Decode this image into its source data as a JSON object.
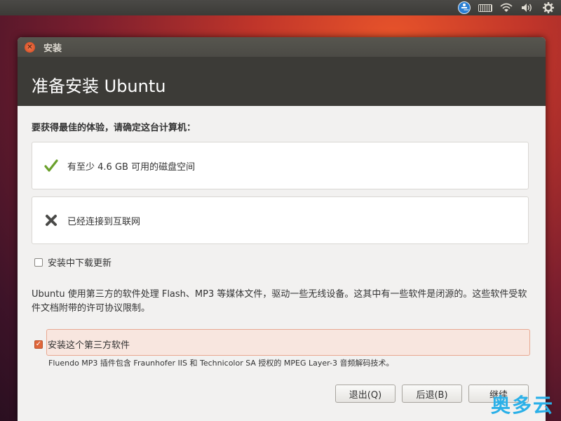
{
  "panel": {
    "icons": [
      "accessibility-icon",
      "keyboard-icon",
      "wifi-icon",
      "volume-icon",
      "gear-icon"
    ]
  },
  "window": {
    "title": "安装",
    "header_title": "准备安装 Ubuntu",
    "prompt": "要获得最佳的体验，请确定这台计算机：",
    "requirements": [
      {
        "text": "有至少 4.6 GB 可用的磁盘空间",
        "status": "ok",
        "icon": "check-icon"
      },
      {
        "text": "已经连接到互联网",
        "status": "fail",
        "icon": "cross-icon"
      }
    ],
    "download_updates": {
      "label": "安装中下载更新",
      "checked": false
    },
    "description": "Ubuntu 使用第三方的软件处理 Flash、MP3 等媒体文件，驱动一些无线设备。这其中有一些软件是闭源的。这些软件受软件文档附带的许可协议限制。",
    "third_party": {
      "label": "安装这个第三方软件",
      "checked": true,
      "check_mark": "✓"
    },
    "third_party_note": "Fluendo MP3 插件包含 Fraunhofer IIS 和 Technicolor SA 授权的 MPEG Layer-3 音频解码技术。",
    "buttons": {
      "quit": "退出(Q)",
      "back": "后退(B)",
      "continue": "继续"
    }
  },
  "watermark": "奥多云",
  "colors": {
    "accent": "#e0663a",
    "header_bg": "#3c3b37",
    "check_green": "#6aa02b"
  }
}
